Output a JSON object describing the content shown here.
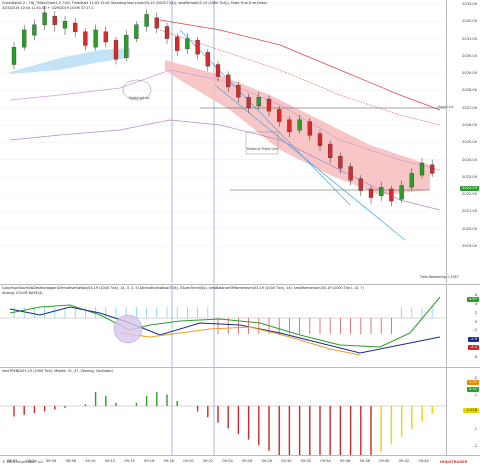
{
  "panel1": {
    "header_line1": "ChainData1.2 - 7HJ_TMainChart1.0 7:00, TimeStart 11:03 15:01 Standing tool chart(03-19 (2000 Tick)), smaPeriod(03-19 (2000 Tick)), False,True,True,False)",
    "header_line2": "3/25/2019 10:54 11:51.00 + 3/29/2019 10:06 37:17:1",
    "price_labels": [
      "2033.00",
      "2032.00",
      "2031.00",
      "2030.00",
      "2029.00",
      "2028.00",
      "2027.00",
      "2026.00",
      "2025.00",
      "2024.00",
      "2023.00",
      "2022.00",
      "2021.00",
      "2020.00",
      "2019.00"
    ],
    "current_price": "2023.25",
    "pivot_label": "Pivot Line",
    "annotation_faded": "Faded set up",
    "annotation_faded2": "Faded at Trend Line",
    "ticks_remaining": "Ticks Remaining = 1057",
    "colors": {
      "up": "#2a9d2a",
      "down": "#d62c2c",
      "cloud_pink": "#f6b8b8",
      "cloud_blue": "#bfe0f6",
      "badge_green": "#2a9d2a"
    }
  },
  "panel2": {
    "header": "ColorVsprStochSwDepthdragger(DerivativeSwBox(03-19 (2000 Tick), 14, 3, 3, 5) DerivativeSwBox(Tick), ESpecTrend(So), smaBalanceOfMomentum(03-19 (2000 Tick), 14), smaMomentum(03-19 (2000 Tick), 14, 7)",
    "header2": "Analog: COLOR BASE(4)",
    "scale_labels": [
      "6",
      "4",
      "2",
      "0",
      "-2",
      "-4",
      "-6",
      "-8"
    ],
    "value_green": "4.97",
    "value_blue": "-2.9",
    "value_red": "-4.5"
  },
  "panel3": {
    "header": "smaTREND(03-19 (2000 Tick), Middle, 51, 47, Zeroing, Oscillator)",
    "scale_labels": [
      "2",
      "1",
      "0",
      "-1",
      "-2"
    ],
    "value_orange": "1.21",
    "value_green": "0.12",
    "value_yellow": "-1.028"
  },
  "time_labels": [
    "08:52",
    "08:54",
    "08:56",
    "08:58",
    "09:10",
    "09:12",
    "09:14",
    "09:16",
    "09:18",
    "09:20",
    "09:22",
    "09:24",
    "09:26",
    "09:28",
    "09:30",
    "09:32",
    "09:34",
    "09:36",
    "09:38",
    "09:40",
    "09:42",
    "09:44"
  ],
  "footer": "© 2019 NinjaTrader, LLC",
  "watermark": "NINJATRADER"
}
